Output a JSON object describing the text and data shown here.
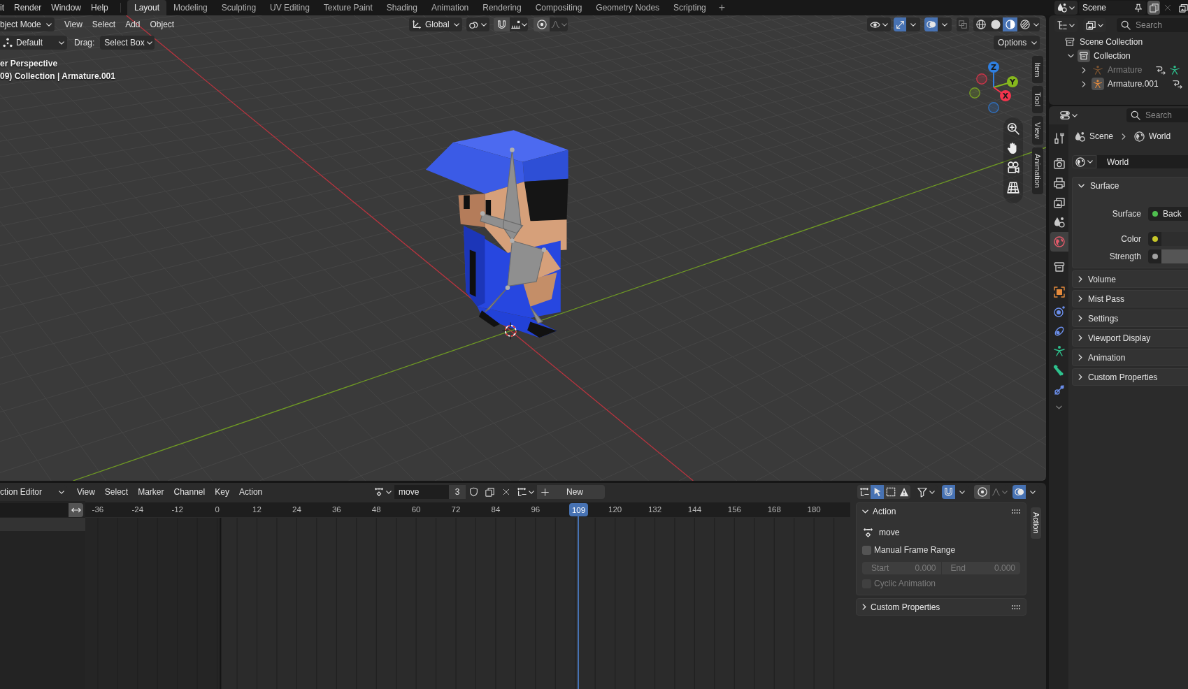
{
  "top_bar": {
    "menus": [
      "it",
      "Render",
      "Window",
      "Help"
    ],
    "workspaces": [
      {
        "label": "Layout",
        "selected": true
      },
      {
        "label": "Modeling",
        "selected": false
      },
      {
        "label": "Sculpting",
        "selected": false
      },
      {
        "label": "UV Editing",
        "selected": false
      },
      {
        "label": "Texture Paint",
        "selected": false
      },
      {
        "label": "Shading",
        "selected": false
      },
      {
        "label": "Animation",
        "selected": false
      },
      {
        "label": "Rendering",
        "selected": false
      },
      {
        "label": "Compositing",
        "selected": false
      },
      {
        "label": "Geometry Nodes",
        "selected": false
      },
      {
        "label": "Scripting",
        "selected": false
      }
    ],
    "add_workspace": "+",
    "scene": "Scene"
  },
  "viewport": {
    "header": {
      "mode": "bject Mode",
      "menus": [
        "View",
        "Select",
        "Add",
        "Object"
      ],
      "orientation": "Global",
      "snap_on": false,
      "proportional_on": false,
      "gizmos_on": true,
      "overlays_on": true,
      "xray_on": false,
      "shading": [
        {
          "kind": "wireframe",
          "selected": false
        },
        {
          "kind": "solid",
          "selected": false
        },
        {
          "kind": "material",
          "selected": true
        },
        {
          "kind": "rendered",
          "selected": false
        }
      ]
    },
    "tool_settings": {
      "orientation": "Default",
      "drag_label": "Drag:",
      "drag_value": "Select Box",
      "options": "Options"
    },
    "info": [
      "er Perspective",
      "09) Collection | Armature.001"
    ],
    "gizmo_axes": [
      {
        "label": "Z",
        "color": "#2f7fe0"
      },
      {
        "label": "Y",
        "color": "#86b81d"
      },
      {
        "label": "X",
        "color": "#f2344d"
      }
    ],
    "sidebar_tabs": [
      {
        "label": "Item",
        "selected": false
      },
      {
        "label": "Tool",
        "selected": false
      },
      {
        "label": "View",
        "selected": false
      },
      {
        "label": "Animation",
        "selected": false
      }
    ]
  },
  "outliner": {
    "search": {
      "placeholder": "Search"
    },
    "tree": [
      {
        "label": "Scene Collection",
        "kind": "scene_collection",
        "active": false,
        "children": [
          {
            "label": "Collection",
            "kind": "collection",
            "expanded": true,
            "active": true,
            "children": [
              {
                "label": "Armature",
                "kind": "armature",
                "expanded": false,
                "active": false,
                "hidden": true,
                "sub_items": [
                  {
                    "kind": "pose"
                  },
                  {
                    "kind": "armature_data"
                  }
                ]
              },
              {
                "label": "Armature.001",
                "kind": "armature",
                "expanded": false,
                "active": true,
                "hidden": false,
                "sub_items": [
                  {
                    "kind": "pose"
                  }
                ]
              }
            ]
          }
        ]
      }
    ]
  },
  "properties": {
    "search": {
      "placeholder": "Search"
    },
    "tabs": [
      {
        "kind": "tool",
        "selected": false
      },
      {
        "kind": "render",
        "selected": false
      },
      {
        "kind": "output",
        "selected": false
      },
      {
        "kind": "view_layer",
        "selected": false
      },
      {
        "kind": "scene",
        "selected": false
      },
      {
        "kind": "world",
        "selected": true
      },
      {
        "kind": "collection",
        "selected": false
      },
      {
        "kind": "object",
        "selected": false
      },
      {
        "kind": "physics",
        "selected": false
      },
      {
        "kind": "constraints",
        "selected": false
      },
      {
        "kind": "data",
        "selected": false
      },
      {
        "kind": "bone",
        "selected": false
      },
      {
        "kind": "bone_constraints",
        "selected": false
      }
    ],
    "breadcrumb": [
      {
        "label": "Scene",
        "kind": "scene"
      },
      {
        "label": "World",
        "kind": "world"
      }
    ],
    "world": "World",
    "panels": [
      {
        "title": "Surface",
        "expanded": true,
        "rows": [
          {
            "kind": "shader",
            "label": "Surface",
            "value": "Back",
            "color": "#4fbf4f"
          },
          {
            "kind": "color",
            "label": "Color",
            "color": "#c7c729"
          },
          {
            "kind": "value",
            "label": "Strength",
            "color": "#a1a1a1"
          }
        ]
      },
      {
        "title": "Volume",
        "expanded": false
      },
      {
        "title": "Mist Pass",
        "expanded": false
      },
      {
        "title": "Settings",
        "expanded": false
      },
      {
        "title": "Viewport Display",
        "expanded": false
      },
      {
        "title": "Animation",
        "expanded": false
      },
      {
        "title": "Custom Properties",
        "expanded": false
      }
    ]
  },
  "action_editor": {
    "mode": "ction Editor",
    "menus": [
      "View",
      "Select",
      "Marker",
      "Channel",
      "Key",
      "Action"
    ],
    "action": {
      "name": "move",
      "users": "3",
      "fake_user": false
    },
    "slot_button": "New",
    "filters": [
      {
        "kind": "summary",
        "on": false
      },
      {
        "kind": "only_selected",
        "on": true
      },
      {
        "kind": "show_hidden",
        "on": false
      },
      {
        "kind": "only_errors",
        "on": false
      }
    ],
    "snap_on": true,
    "proportional_on": false,
    "overlays_on": true,
    "frame_ticks": [
      "-36",
      "-24",
      "-12",
      "0",
      "12",
      "24",
      "36",
      "48",
      "60",
      "72",
      "84",
      "96",
      "120",
      "132",
      "144",
      "156",
      "168",
      "180"
    ],
    "current_frame": "109",
    "sidebar": {
      "tabs": [
        {
          "label": "Action",
          "selected": true
        }
      ],
      "action_panel": {
        "title": "Action",
        "expanded": true,
        "action_name": "move",
        "manual_range": {
          "label": "Manual Frame Range",
          "checked": false
        },
        "start": {
          "label": "Start",
          "value": "0.000",
          "disabled": true
        },
        "end": {
          "label": "End",
          "value": "0.000",
          "disabled": true
        },
        "cyclic": {
          "label": "Cyclic Animation",
          "checked": false,
          "disabled": true
        }
      },
      "custom_panel": {
        "title": "Custom Properties",
        "expanded": false
      }
    }
  }
}
